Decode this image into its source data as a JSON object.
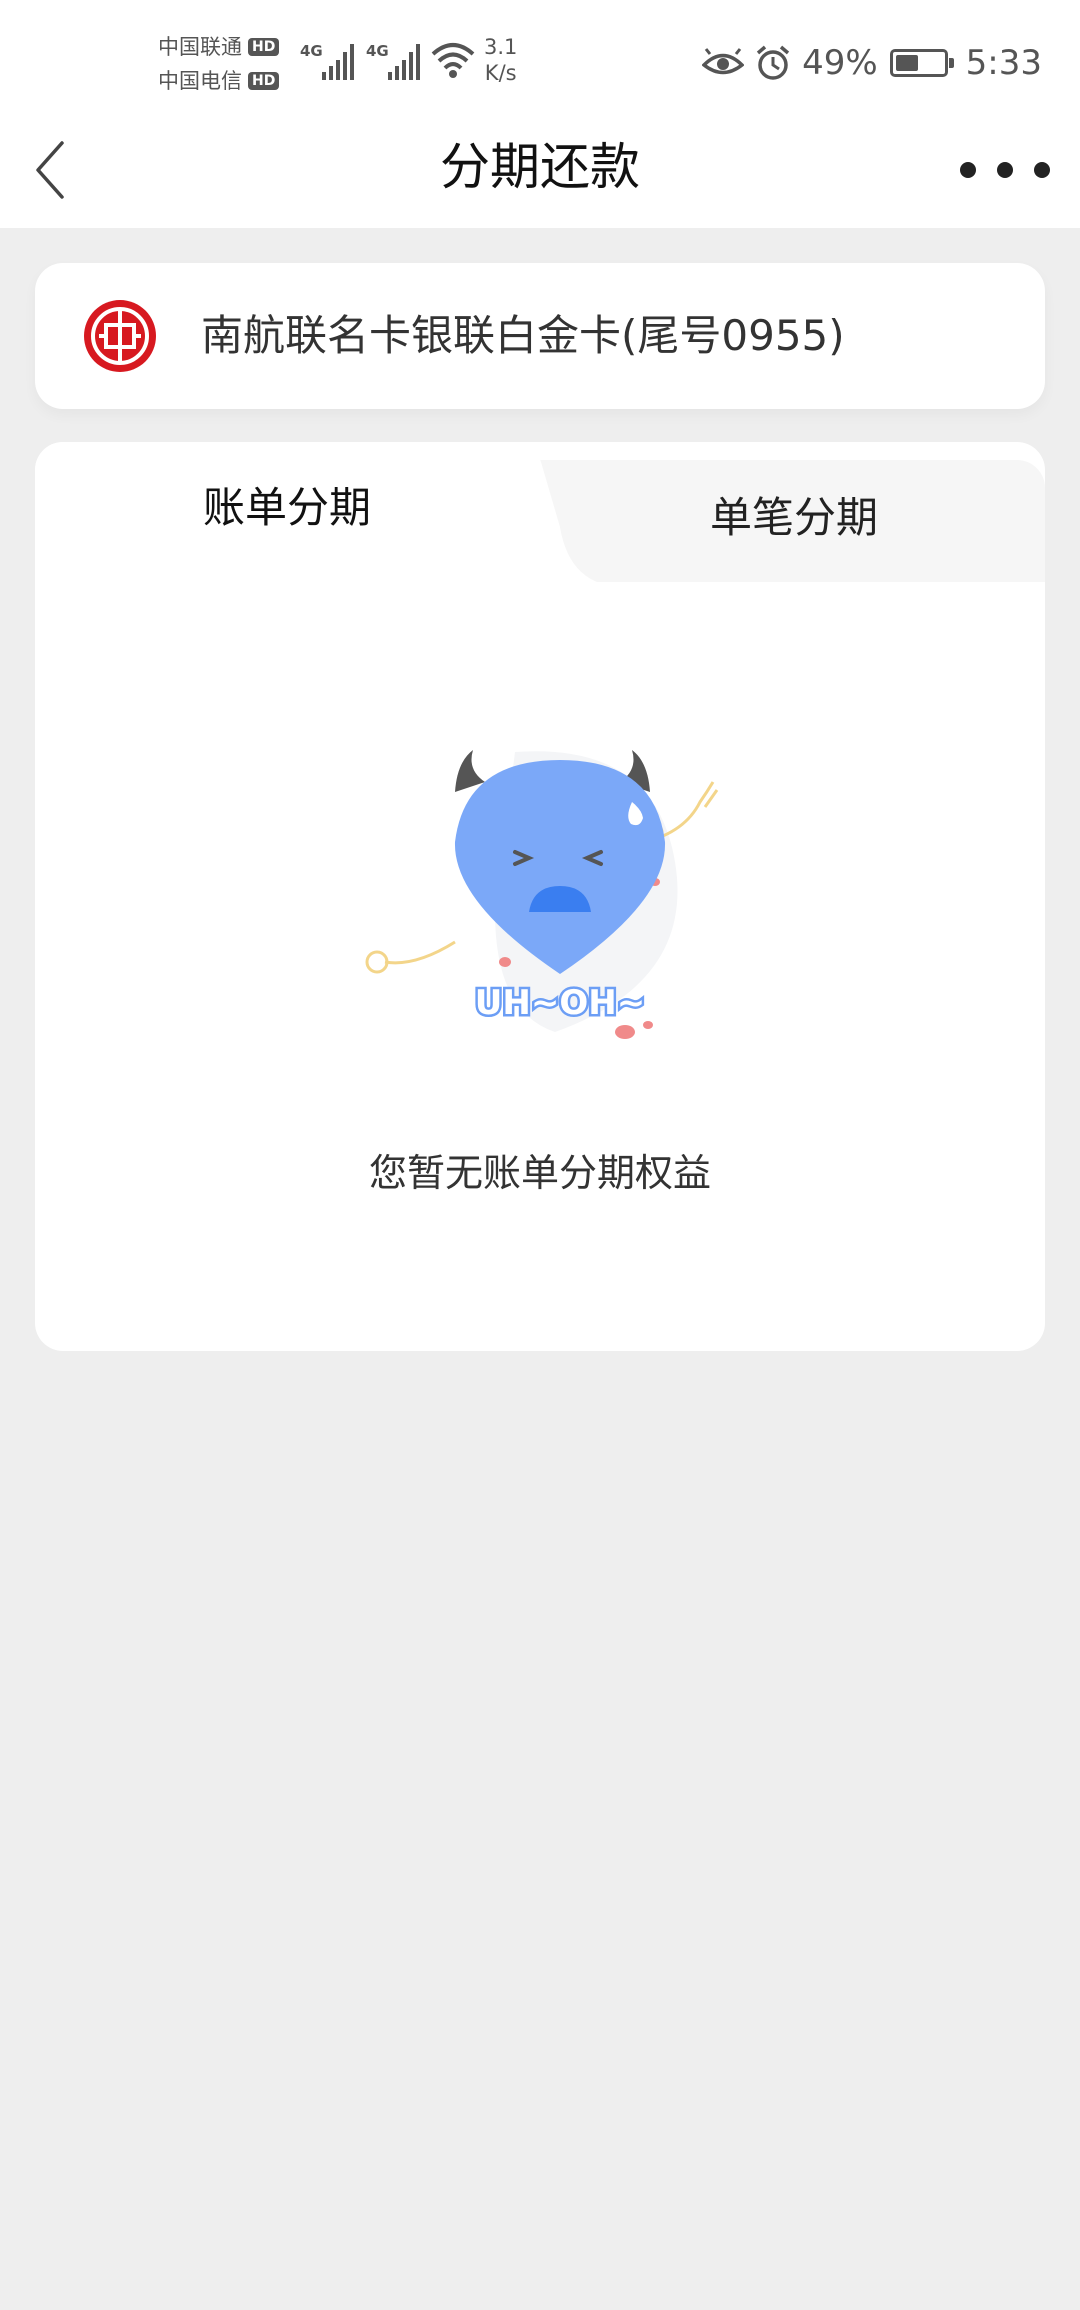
{
  "status_bar": {
    "carrier1": "中国联通",
    "carrier2": "中国电信",
    "hd_badge": "HD",
    "network_type": "4G",
    "net_speed_value": "3.1",
    "net_speed_unit": "K/s",
    "battery_percent": "49%",
    "battery_level": 0.49,
    "time": "5:33"
  },
  "navbar": {
    "title": "分期还款"
  },
  "card": {
    "name": "南航联名卡银联白金卡(尾号0955)",
    "brand_color": "#d71920"
  },
  "tabs": [
    {
      "label": "账单分期",
      "active": true
    },
    {
      "label": "单笔分期",
      "active": false
    }
  ],
  "empty_state": {
    "illustration_text": "UH~OH~",
    "message": "您暂无账单分期权益"
  }
}
